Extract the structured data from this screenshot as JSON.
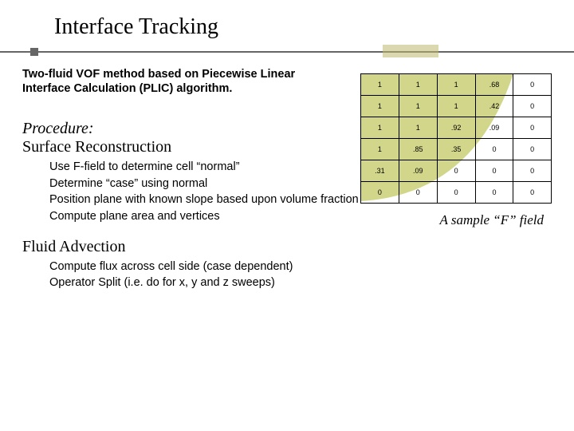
{
  "title": "Interface Tracking",
  "intro_line1": "Two-fluid VOF method based on Piecewise Linear",
  "intro_line2": "Interface Calculation (PLIC) algorithm.",
  "section1_head": "Procedure:",
  "section1_sub": "Surface Reconstruction",
  "section1_items": [
    "Use F-field to determine cell “normal”",
    "Determine “case” using normal",
    "Position plane with known slope based upon volume fraction",
    "Compute plane area and vertices"
  ],
  "section2_head": "Fluid Advection",
  "section2_items": [
    "Compute flux across cell side (case dependent)",
    "Operator Split (i.e. do for x, y and z sweeps)"
  ],
  "caption": "A sample “F” field",
  "chart_data": {
    "type": "table",
    "title": "A sample \"F\" field",
    "rows": 6,
    "cols": 5,
    "values": [
      [
        "1",
        "1",
        "1",
        ".68",
        "0"
      ],
      [
        "1",
        "1",
        "1",
        ".42",
        "0"
      ],
      [
        "1",
        "1",
        ".92",
        ".09",
        "0"
      ],
      [
        "1",
        ".85",
        ".35",
        "0",
        "0"
      ],
      [
        ".31",
        ".09",
        "0",
        "0",
        "0"
      ],
      [
        "0",
        "0",
        "0",
        "0",
        "0"
      ]
    ],
    "fluid_color": "#d2d68a"
  }
}
